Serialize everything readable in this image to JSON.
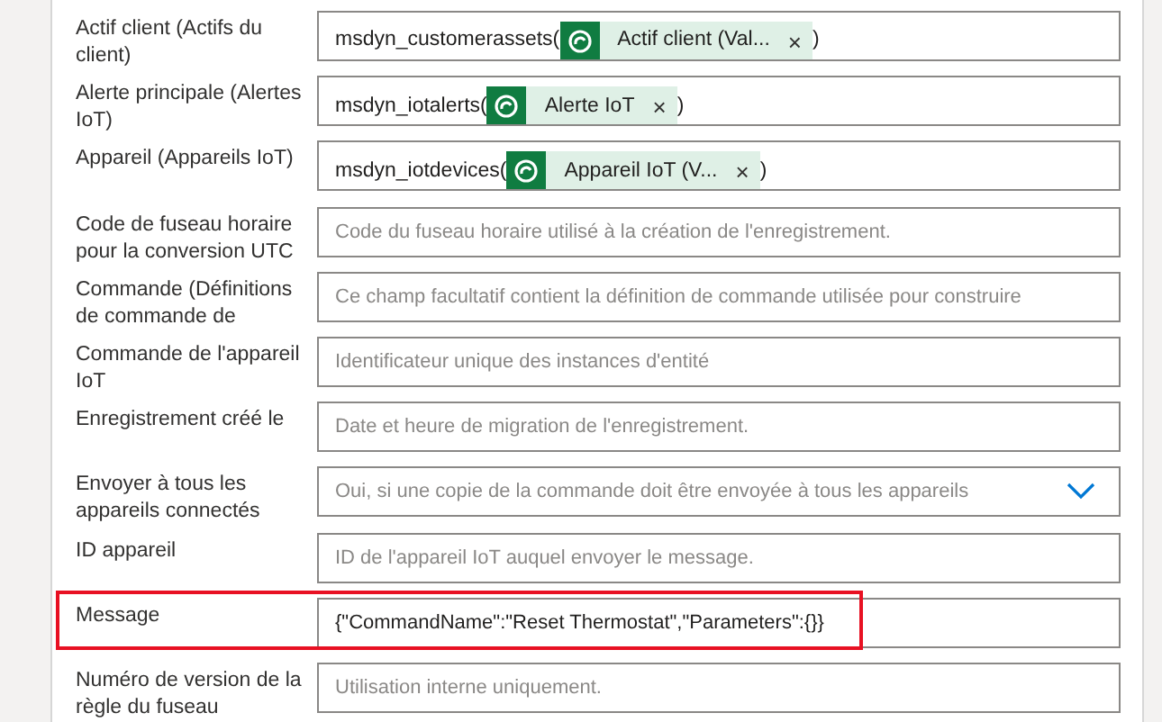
{
  "fields": [
    {
      "label": "Actif client (Actifs du client)",
      "kind": "lookup",
      "prefix": "msdyn_customerassets(",
      "tag": "Actif client (Val...",
      "remove": "×",
      "suffix": ")",
      "highlighted": false
    },
    {
      "label": "Alerte principale (Alertes IoT)",
      "kind": "lookup",
      "prefix": "msdyn_iotalerts(",
      "tag": "Alerte IoT",
      "remove": "×",
      "suffix": ")",
      "highlighted": false
    },
    {
      "label": "Appareil (Appareils IoT)",
      "kind": "lookup",
      "prefix": "msdyn_iotdevices(",
      "tag": "Appareil IoT (V...",
      "remove": "×",
      "suffix": ")",
      "highlighted": false
    },
    {
      "label": "Code de fuseau horaire pour la conversion UTC",
      "kind": "text",
      "placeholder": "Code du fuseau horaire utilisé à la création de l'enregistrement.",
      "highlighted": false
    },
    {
      "label": "Commande (Définitions de commande de",
      "kind": "text",
      "placeholder": "Ce champ facultatif contient la définition de commande utilisée pour construire",
      "highlighted": false
    },
    {
      "label": "Commande de l'appareil IoT",
      "kind": "text",
      "placeholder": "Identificateur unique des instances d'entité",
      "highlighted": false
    },
    {
      "label": "Enregistrement créé le",
      "kind": "text",
      "placeholder": "Date et heure de migration de l'enregistrement.",
      "highlighted": false
    },
    {
      "label": "Envoyer à tous les appareils connectés",
      "kind": "choice",
      "placeholder": "Oui, si une copie de la commande doit être envoyée à tous les appareils",
      "highlighted": false
    },
    {
      "label": "ID appareil",
      "kind": "text",
      "placeholder": "ID de l'appareil IoT auquel envoyer le message.",
      "highlighted": false
    },
    {
      "label": "Message",
      "kind": "text",
      "value": "{\"CommandName\":\"Reset Thermostat\",\"Parameters\":{}}",
      "highlighted": true
    },
    {
      "label": "Numéro de version de la règle du fuseau",
      "kind": "text",
      "placeholder": "Utilisation interne uniquement.",
      "highlighted": false
    }
  ]
}
